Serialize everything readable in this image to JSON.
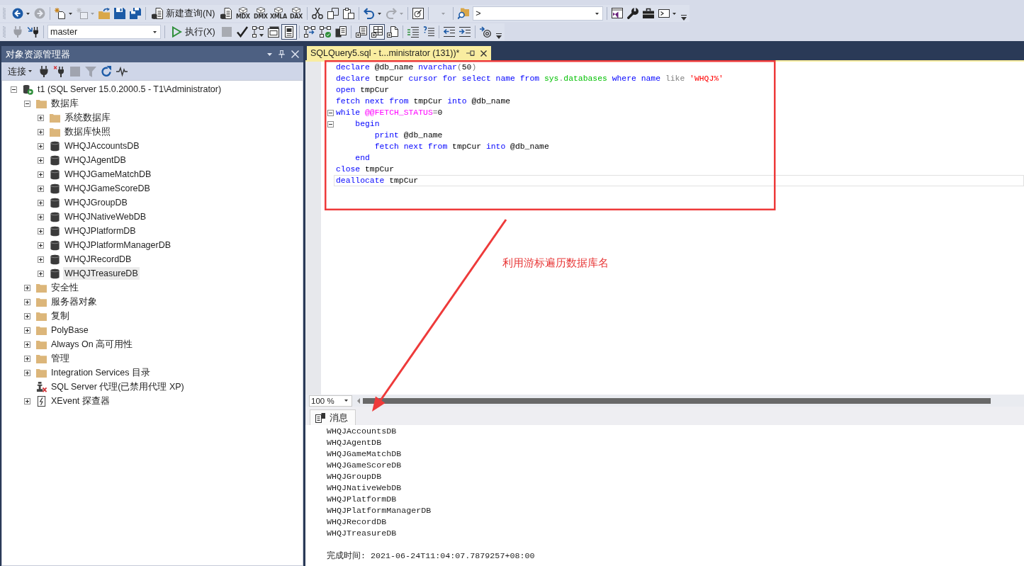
{
  "toolbars": [
    {
      "groups": [
        {
          "items": [
            {
              "kind": "split",
              "disabled": false
            },
            {
              "kind": "icon",
              "disabled": true
            }
          ]
        },
        {
          "items": [
            {
              "kind": "split",
              "disabled": false
            },
            {
              "kind": "split",
              "disabled": true
            },
            {
              "kind": "icon",
              "disabled": false
            },
            {
              "kind": "icon",
              "disabled": false
            },
            {
              "kind": "icon",
              "disabled": false
            }
          ]
        },
        {
          "items": [
            {
              "kind": "button",
              "label": "新建查询(N)",
              "disabled": false
            },
            {
              "kind": "icon",
              "disabled": false
            },
            {
              "kind": "query",
              "label": "MDX",
              "disabled": false
            },
            {
              "kind": "query",
              "label": "DMX",
              "disabled": false
            },
            {
              "kind": "query",
              "label": "XMLA",
              "disabled": false
            },
            {
              "kind": "query",
              "label": "DAX",
              "disabled": false
            }
          ]
        },
        {
          "items": [
            {
              "kind": "icon",
              "disabled": false
            },
            {
              "kind": "icon",
              "disabled": false
            },
            {
              "kind": "icon",
              "disabled": false
            }
          ]
        },
        {
          "items": [
            {
              "kind": "split",
              "disabled": false
            },
            {
              "kind": "split",
              "disabled": true
            }
          ]
        },
        {
          "items": [
            {
              "kind": "icon",
              "disabled": false
            }
          ]
        },
        {
          "items": [
            {
              "kind": "combo",
              "disabled": true
            }
          ]
        },
        {
          "items": [
            {
              "kind": "icon",
              "disabled": false
            },
            {
              "kind": "combo",
              "value": ">",
              "disabled": false
            }
          ]
        },
        {
          "items": [
            {
              "kind": "icon",
              "disabled": false
            },
            {
              "kind": "icon",
              "disabled": false
            },
            {
              "kind": "icon",
              "disabled": false
            },
            {
              "kind": "split",
              "disabled": false
            }
          ]
        }
      ]
    },
    {
      "groups": [
        {
          "items": [
            {
              "kind": "icon",
              "disabled": true
            },
            {
              "kind": "icon",
              "disabled": false
            }
          ]
        },
        {
          "items": [
            {
              "kind": "combo",
              "value": "master",
              "disabled": false
            }
          ]
        },
        {
          "items": [
            {
              "kind": "button",
              "label": "执行(X)",
              "disabled": false,
              "pressed": false
            },
            {
              "kind": "icon",
              "disabled": true,
              "pressed": false
            },
            {
              "kind": "icon",
              "disabled": false,
              "pressed": false
            },
            {
              "kind": "icon",
              "disabled": false,
              "pressed": false
            },
            {
              "kind": "icon",
              "disabled": false,
              "pressed": false
            },
            {
              "kind": "icon",
              "disabled": false,
              "pressed": true
            }
          ]
        },
        {
          "items": [
            {
              "kind": "icon",
              "disabled": false
            },
            {
              "kind": "icon",
              "disabled": false
            },
            {
              "kind": "icon",
              "disabled": false
            }
          ]
        },
        {
          "items": [
            {
              "kind": "icon",
              "disabled": false,
              "pressed": false
            },
            {
              "kind": "icon",
              "disabled": false,
              "pressed": true
            },
            {
              "kind": "icon",
              "disabled": false,
              "pressed": false
            }
          ]
        },
        {
          "items": [
            {
              "kind": "icon",
              "disabled": false
            },
            {
              "kind": "icon",
              "disabled": false
            }
          ]
        },
        {
          "items": [
            {
              "kind": "icon",
              "disabled": false
            },
            {
              "kind": "icon",
              "disabled": false
            }
          ]
        },
        {
          "items": [
            {
              "kind": "icon",
              "disabled": false
            }
          ]
        }
      ]
    }
  ],
  "object_explorer": {
    "title": "对象资源管理器",
    "connect_label": "连接",
    "tools": [
      {
        "disabled": false
      },
      {
        "disabled": false
      },
      {
        "disabled": true
      },
      {
        "disabled": true
      },
      {
        "disabled": false
      },
      {
        "disabled": false
      }
    ],
    "tree": [
      {
        "label": "t1 (SQL Server 15.0.2000.5 - T1\\Administrator)",
        "kind": "server",
        "expanded": true,
        "selected": false,
        "children": [
          {
            "label": "数据库",
            "kind": "folder",
            "expanded": true,
            "selected": false,
            "children": [
              {
                "label": "系统数据库",
                "kind": "folder",
                "expanded": false,
                "selected": false
              },
              {
                "label": "数据库快照",
                "kind": "folder",
                "expanded": false,
                "selected": false
              },
              {
                "label": "WHQJAccountsDB",
                "kind": "database",
                "expanded": false,
                "selected": false
              },
              {
                "label": "WHQJAgentDB",
                "kind": "database",
                "expanded": false,
                "selected": false
              },
              {
                "label": "WHQJGameMatchDB",
                "kind": "database",
                "expanded": false,
                "selected": false
              },
              {
                "label": "WHQJGameScoreDB",
                "kind": "database",
                "expanded": false,
                "selected": false
              },
              {
                "label": "WHQJGroupDB",
                "kind": "database",
                "expanded": false,
                "selected": false
              },
              {
                "label": "WHQJNativeWebDB",
                "kind": "database",
                "expanded": false,
                "selected": false
              },
              {
                "label": "WHQJPlatformDB",
                "kind": "database",
                "expanded": false,
                "selected": false
              },
              {
                "label": "WHQJPlatformManagerDB",
                "kind": "database",
                "expanded": false,
                "selected": false
              },
              {
                "label": "WHQJRecordDB",
                "kind": "database",
                "expanded": false,
                "selected": false
              },
              {
                "label": "WHQJTreasureDB",
                "kind": "database",
                "expanded": false,
                "selected": true
              }
            ]
          },
          {
            "label": "安全性",
            "kind": "folder",
            "expanded": false,
            "selected": false
          },
          {
            "label": "服务器对象",
            "kind": "folder",
            "expanded": false,
            "selected": false
          },
          {
            "label": "复制",
            "kind": "folder",
            "expanded": false,
            "selected": false
          },
          {
            "label": "PolyBase",
            "kind": "folder",
            "expanded": false,
            "selected": false
          },
          {
            "label": "Always On 高可用性",
            "kind": "folder",
            "expanded": false,
            "selected": false
          },
          {
            "label": "管理",
            "kind": "folder",
            "expanded": false,
            "selected": false
          },
          {
            "label": "Integration Services 目录",
            "kind": "folder",
            "expanded": false,
            "selected": false
          },
          {
            "label": "SQL Server 代理(已禁用代理 XP)",
            "kind": "agent",
            "leaf": true,
            "selected": false
          },
          {
            "label": "XEvent 探查器",
            "kind": "xevent",
            "expanded": false,
            "selected": false
          }
        ]
      }
    ]
  },
  "editor": {
    "tabs": [
      {
        "title": "SQLQuery5.sql - t...ministrator (131))*",
        "selected": true
      }
    ],
    "lines": [
      {
        "tokens": [
          {
            "text": "declare",
            "kind": "keyword"
          },
          {
            "text": " @db_name ",
            "kind": "plain"
          },
          {
            "text": "nvarchar",
            "kind": "keyword"
          },
          {
            "text": "(",
            "kind": "operator"
          },
          {
            "text": "50",
            "kind": "plain"
          },
          {
            "text": ")",
            "kind": "operator"
          }
        ],
        "fold": false,
        "current": false
      },
      {
        "tokens": [
          {
            "text": "declare",
            "kind": "keyword"
          },
          {
            "text": " tmpCur ",
            "kind": "plain"
          },
          {
            "text": "cursor for select name from ",
            "kind": "keyword"
          },
          {
            "text": "sys",
            "kind": "system"
          },
          {
            "text": ".",
            "kind": "operator"
          },
          {
            "text": "databases ",
            "kind": "system"
          },
          {
            "text": "where name ",
            "kind": "keyword"
          },
          {
            "text": "like ",
            "kind": "operator"
          },
          {
            "text": "'WHQJ%'",
            "kind": "string"
          }
        ],
        "fold": false,
        "current": false
      },
      {
        "tokens": [
          {
            "text": "open",
            "kind": "keyword"
          },
          {
            "text": " tmpCur",
            "kind": "plain"
          }
        ],
        "fold": false,
        "current": false
      },
      {
        "tokens": [
          {
            "text": "fetch next from",
            "kind": "keyword"
          },
          {
            "text": " tmpCur ",
            "kind": "plain"
          },
          {
            "text": "into",
            "kind": "keyword"
          },
          {
            "text": " @db_name",
            "kind": "plain"
          }
        ],
        "fold": false,
        "current": false
      },
      {
        "tokens": [
          {
            "text": "while ",
            "kind": "keyword"
          },
          {
            "text": "@@FETCH_STATUS",
            "kind": "variable"
          },
          {
            "text": "=",
            "kind": "operator"
          },
          {
            "text": "0",
            "kind": "plain"
          }
        ],
        "fold": true,
        "current": false
      },
      {
        "tokens": [
          {
            "text": "    begin",
            "kind": "keyword"
          }
        ],
        "fold": true,
        "current": false
      },
      {
        "tokens": [
          {
            "text": "        print",
            "kind": "keyword"
          },
          {
            "text": " @db_name",
            "kind": "plain"
          }
        ],
        "fold": false,
        "current": false
      },
      {
        "tokens": [
          {
            "text": "        fetch next from",
            "kind": "keyword"
          },
          {
            "text": " tmpCur ",
            "kind": "plain"
          },
          {
            "text": "into",
            "kind": "keyword"
          },
          {
            "text": " @db_name",
            "kind": "plain"
          }
        ],
        "fold": false,
        "current": false
      },
      {
        "tokens": [
          {
            "text": "    end",
            "kind": "keyword"
          }
        ],
        "fold": false,
        "current": false
      },
      {
        "tokens": [
          {
            "text": "close",
            "kind": "keyword"
          },
          {
            "text": " tmpCur",
            "kind": "plain"
          }
        ],
        "fold": false,
        "current": false
      },
      {
        "tokens": [
          {
            "text": "deallocate",
            "kind": "keyword"
          },
          {
            "text": " tmpCur",
            "kind": "plain"
          }
        ],
        "fold": false,
        "current": true
      }
    ],
    "zoom": "100 %"
  },
  "results": {
    "tabs": [
      {
        "label": "消息",
        "selected": true
      }
    ],
    "messages": [
      "WHQJAccountsDB",
      "WHQJAgentDB",
      "WHQJGameMatchDB",
      "WHQJGameScoreDB",
      "WHQJGroupDB",
      "WHQJNativeWebDB",
      "WHQJPlatformDB",
      "WHQJPlatformManagerDB",
      "WHQJRecordDB",
      "WHQJTreasureDB"
    ],
    "completion_time": "完成时间: 2021-06-24T11:04:07.7879257+08:00"
  },
  "annotation": {
    "text": "利用游标遍历数据库名"
  }
}
